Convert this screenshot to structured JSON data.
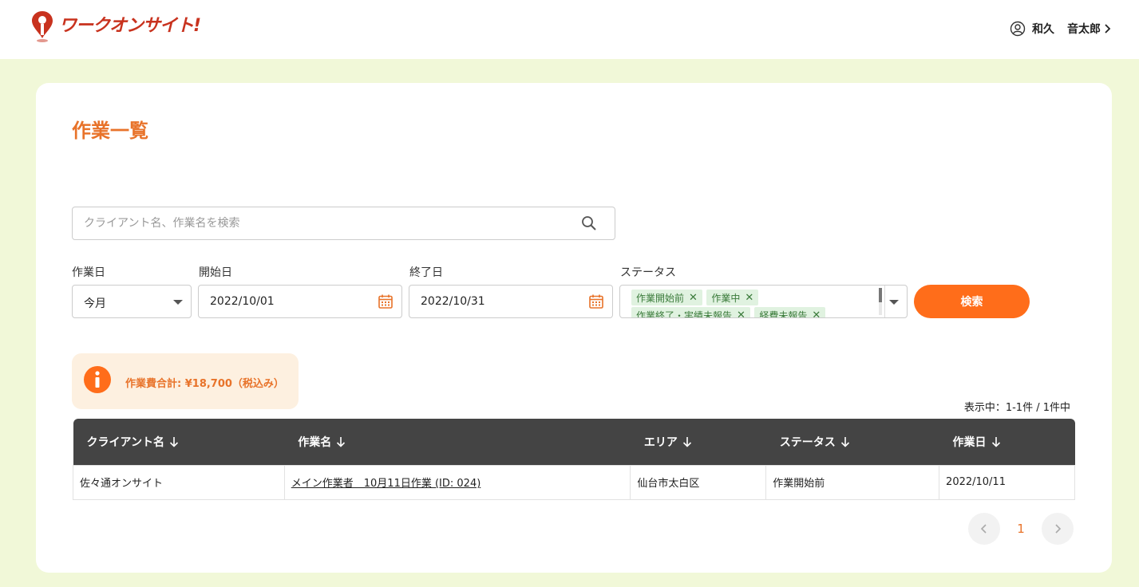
{
  "header": {
    "brand": "ワークオンサイト!",
    "user_family": "和久",
    "user_given": "音太郎"
  },
  "page": {
    "title": "作業一覧"
  },
  "search": {
    "placeholder": "クライアント名、作業名を検索"
  },
  "filters": {
    "work_date_label": "作業日",
    "work_date_value": "今月",
    "start_label": "開始日",
    "start_value": "2022/10/01",
    "end_label": "終了日",
    "end_value": "2022/10/31",
    "status_label": "ステータス",
    "status_chips": [
      "作業開始前",
      "作業中",
      "作業終了・実績未報告",
      "経費未報告"
    ],
    "search_button": "検索"
  },
  "summary": {
    "total_text": "作業費合計: ¥18,700（税込み）",
    "count_text": "表示中：1-1件 / 1件中"
  },
  "table": {
    "headers": [
      "クライアント名",
      "作業名",
      "エリア",
      "ステータス",
      "作業日"
    ],
    "rows": [
      {
        "client": "佐々通オンサイト",
        "work": "メイン作業者　10月11日作業 (ID: 024)",
        "area": "仙台市太白区",
        "status": "作業開始前",
        "date": "2022/10/11"
      }
    ]
  },
  "pagination": {
    "current": "1"
  },
  "colors": {
    "accent": "#ff6d1a",
    "title": "#e8732a",
    "background": "#f1f8d8",
    "table_header": "#444444",
    "chip_bg": "#e0f2e0"
  },
  "icons": {
    "logo": "location-pin-logo",
    "user": "user-circle-icon",
    "search": "search-icon",
    "calendar": "calendar-icon",
    "info": "info-icon",
    "sort": "arrow-down-icon"
  }
}
